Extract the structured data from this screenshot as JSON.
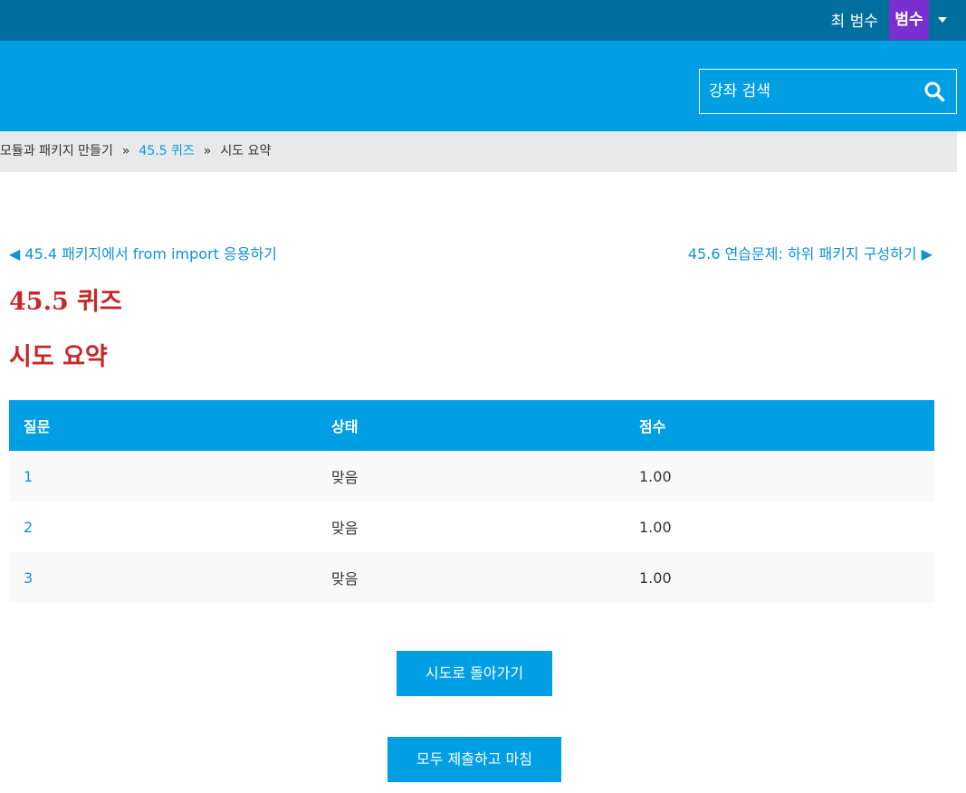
{
  "header": {
    "user_name": "최 범수",
    "avatar_text": "범수"
  },
  "search": {
    "placeholder": "강좌 검색"
  },
  "breadcrumb": {
    "items": [
      "모듈과 패키지 만들기",
      "45.5 퀴즈",
      "시도 요약"
    ],
    "separator": "»"
  },
  "navigation": {
    "prev_label": "◀ 45.4 패키지에서 from import 응용하기",
    "next_label": "45.6 연습문제: 하위 패키지 구성하기 ▶"
  },
  "page": {
    "title": "45.5 퀴즈",
    "subtitle": "시도 요약"
  },
  "table": {
    "headers": [
      "질문",
      "상태",
      "점수"
    ],
    "rows": [
      {
        "question": "1",
        "status": "맞음",
        "score": "1.00"
      },
      {
        "question": "2",
        "status": "맞음",
        "score": "1.00"
      },
      {
        "question": "3",
        "status": "맞음",
        "score": "1.00"
      }
    ]
  },
  "buttons": {
    "back_label": "시도로 돌아가기",
    "submit_label": "모두 제출하고 마침"
  },
  "colors": {
    "topbar": "#006f9e",
    "primary": "#009fe3",
    "heading": "#c62828",
    "avatar": "#7a2fd0",
    "link": "#0e93d4"
  },
  "icons": {
    "search": "search-icon",
    "user_menu": "caret-down-icon"
  }
}
